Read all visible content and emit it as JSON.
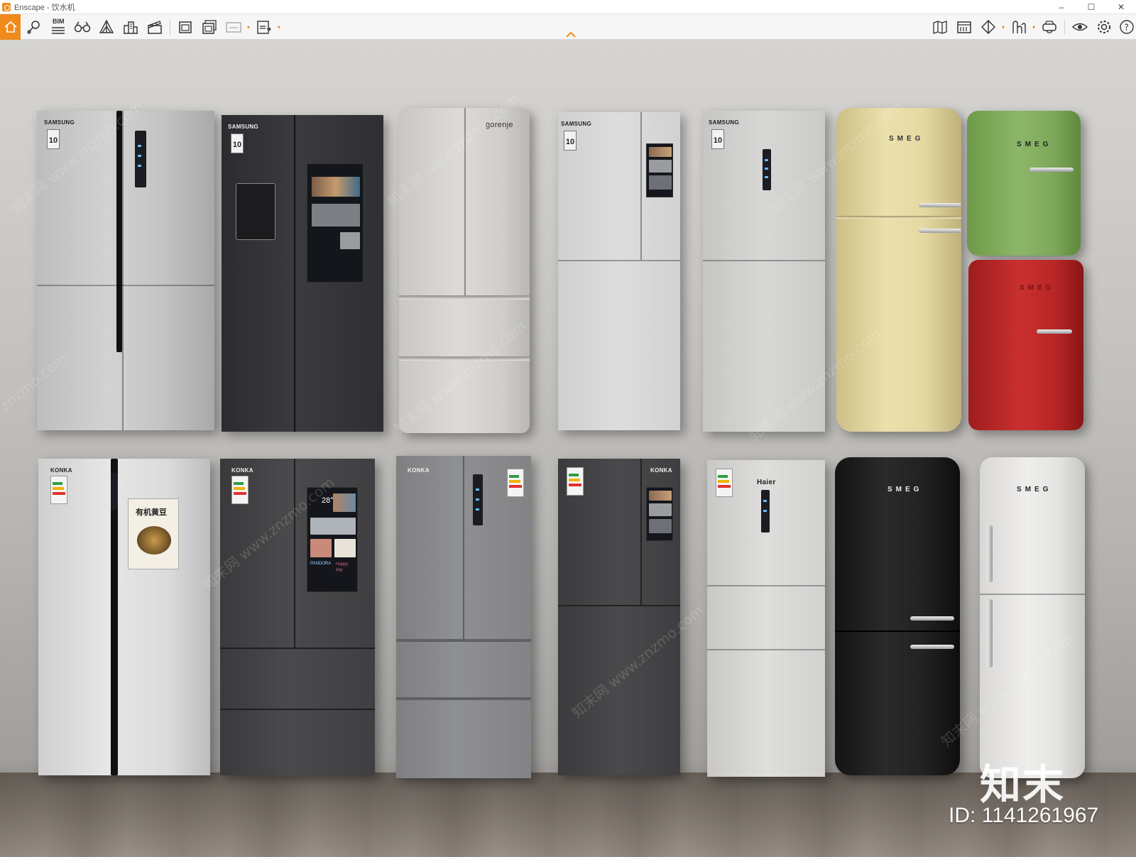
{
  "window": {
    "title": "Enscape - 饮水机",
    "minimize": "–",
    "maximize": "☐",
    "close": "✕"
  },
  "toolbar": {
    "bim_label": "BIM",
    "left_icons": [
      "home-icon",
      "pin-icon",
      "bim-list-icon",
      "binoculars-icon",
      "perspective-icon",
      "buildings-icon",
      "clapper-icon",
      "screenshot-icon",
      "batch-render-icon",
      "panorama-360-icon",
      "export-exe-icon"
    ],
    "right_icons": [
      "map-icon",
      "asset-library-icon",
      "visual-settings-icon",
      "material-editor-icon",
      "vr-headset-icon",
      "view-icon",
      "settings-icon",
      "help-icon"
    ],
    "accent_color": "#f08a1c"
  },
  "scene": {
    "top_row": [
      {
        "brand": "SAMSUNG",
        "badge": "10"
      },
      {
        "brand": "SAMSUNG",
        "badge": "10"
      },
      {
        "brand": "gorenje"
      },
      {
        "brand": "SAMSUNG",
        "badge": "10"
      },
      {
        "brand": "SAMSUNG",
        "badge": "10"
      },
      {
        "brand": "SMEG"
      },
      {
        "brand": "SMEG"
      },
      {
        "brand": "SMEG"
      }
    ],
    "bottom_row": [
      {
        "brand": "KONKA",
        "poster": "有机黄豆"
      },
      {
        "brand": "KONKA",
        "screen_temp": "28°",
        "screen_label": "PANDORA",
        "screen_tag": "Happy day"
      },
      {
        "brand": "KONKA"
      },
      {
        "brand": "KONKA"
      },
      {
        "brand": "Haier"
      },
      {
        "brand": "SMEG"
      },
      {
        "brand": "SMEG"
      }
    ],
    "watermark_text": "知末网 www.znzmo.com",
    "watermark_short": "znzmo.com",
    "logo_text": "知末",
    "id_text": "ID: 1141261967"
  }
}
